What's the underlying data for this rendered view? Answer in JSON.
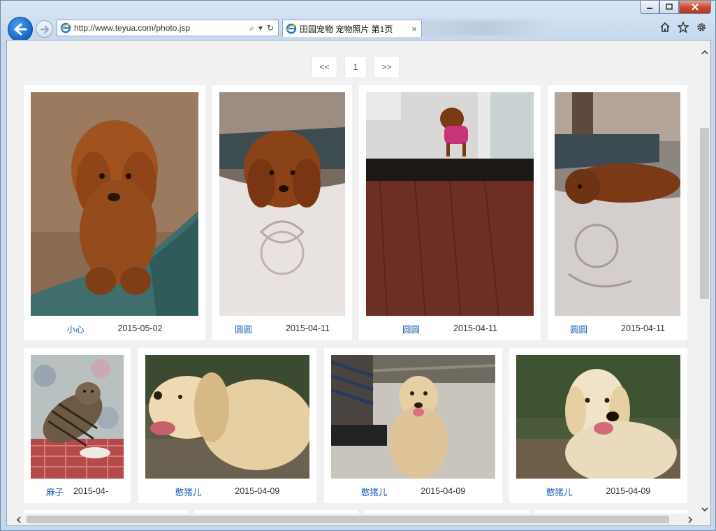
{
  "browser": {
    "url": "http://www.teyua.com/photo.jsp",
    "tab_title": "田园宠物 宠物照片 第1页",
    "tab_close": "×",
    "search_glyph": "⌕",
    "dropdown_glyph": "▾",
    "refresh_glyph": "↻"
  },
  "pager": {
    "prev": "<<",
    "current": "1",
    "next": ">>"
  },
  "photos": [
    {
      "name": "小心",
      "date": "2015-05-02",
      "subject": "brown-poodle-sitting"
    },
    {
      "name": "圆圆",
      "date": "2015-04-11",
      "subject": "brown-poodle-on-pillow"
    },
    {
      "name": "圆圆",
      "date": "2015-04-11",
      "subject": "poodle-in-doorway"
    },
    {
      "name": "圆圆",
      "date": "2015-04-11",
      "subject": "poodle-lying-on-pillow"
    },
    {
      "name": "麻子",
      "date": "2015-04-",
      "subject": "tabby-cat"
    },
    {
      "name": "憨猪儿",
      "date": "2015-04-09",
      "subject": "golden-retriever-side"
    },
    {
      "name": "憨猪儿",
      "date": "2015-04-09",
      "subject": "golden-retriever-with-owner"
    },
    {
      "name": "憨猪儿",
      "date": "2015-04-09",
      "subject": "golden-retriever-front"
    }
  ],
  "colors": {
    "link": "#1a5fb4",
    "page_bg": "#f1f1f1",
    "ie_blue": "#1563c6"
  }
}
